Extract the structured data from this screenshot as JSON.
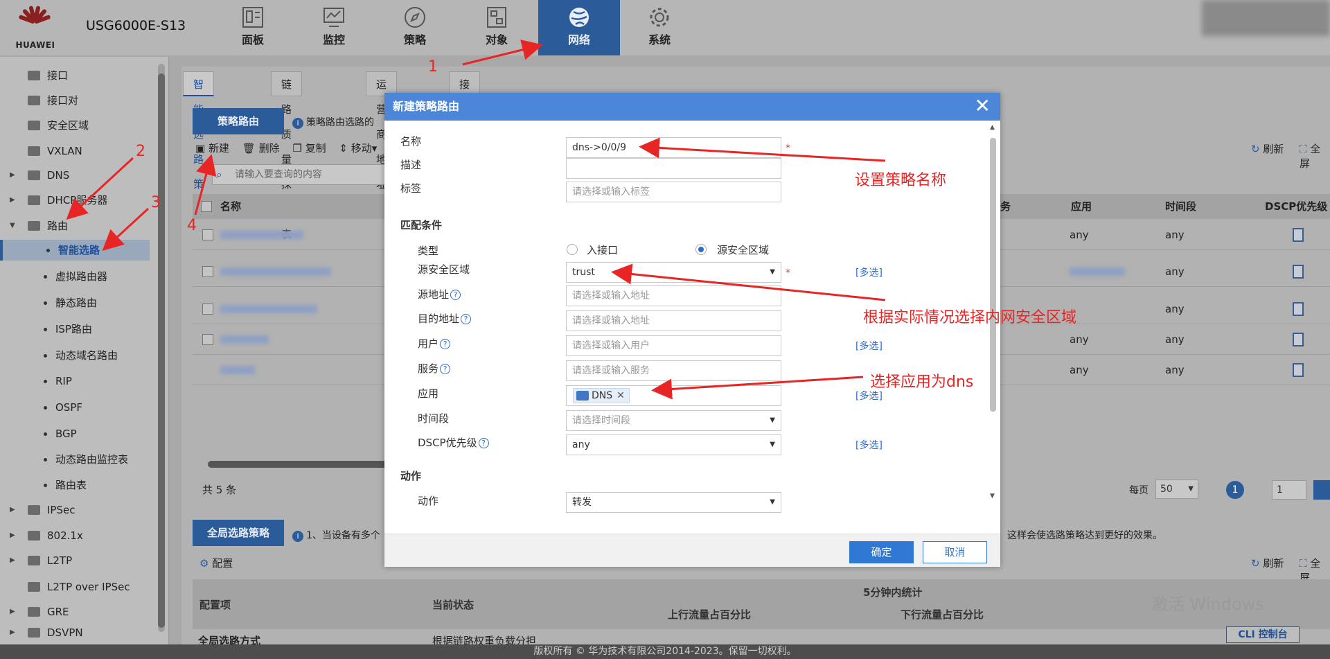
{
  "header": {
    "brand": "HUAWEI",
    "model": "USG6000E-S13",
    "nav": [
      {
        "label": "面板"
      },
      {
        "label": "监控"
      },
      {
        "label": "策略"
      },
      {
        "label": "对象"
      },
      {
        "label": "网络",
        "active": true
      },
      {
        "label": "系统"
      }
    ]
  },
  "sidebar": {
    "items": [
      {
        "label": "接口",
        "level": 1
      },
      {
        "label": "接口对",
        "level": 1
      },
      {
        "label": "安全区域",
        "level": 1
      },
      {
        "label": "VXLAN",
        "level": 1
      },
      {
        "label": "DNS",
        "level": 1,
        "expandable": true
      },
      {
        "label": "DHCP服务器",
        "level": 1,
        "expandable": true
      },
      {
        "label": "路由",
        "level": 1,
        "expanded": true
      },
      {
        "label": "智能选路",
        "level": 2,
        "active": true
      },
      {
        "label": "虚拟路由器",
        "level": 2
      },
      {
        "label": "静态路由",
        "level": 2
      },
      {
        "label": "ISP路由",
        "level": 2
      },
      {
        "label": "动态域名路由",
        "level": 2
      },
      {
        "label": "RIP",
        "level": 2
      },
      {
        "label": "OSPF",
        "level": 2
      },
      {
        "label": "BGP",
        "level": 2
      },
      {
        "label": "动态路由监控表",
        "level": 2
      },
      {
        "label": "路由表",
        "level": 2
      },
      {
        "label": "IPSec",
        "level": 1,
        "expandable": true
      },
      {
        "label": "802.1x",
        "level": 1,
        "expandable": true
      },
      {
        "label": "L2TP",
        "level": 1,
        "expandable": true
      },
      {
        "label": "L2TP over IPSec",
        "level": 1
      },
      {
        "label": "GRE",
        "level": 1,
        "expandable": true
      },
      {
        "label": "DSVPN",
        "level": 1,
        "expandable": true
      }
    ]
  },
  "tabs": [
    {
      "label": "智能选路策略",
      "active": true
    },
    {
      "label": "链路质量探测表"
    },
    {
      "label": "运营商地址库"
    },
    {
      "label": "接口组"
    }
  ],
  "policy_section": {
    "title": "策略路由",
    "info": "策略路由选路的",
    "toolbar": {
      "new": "新建",
      "delete": "删除",
      "copy": "复制",
      "move": "移动▾"
    },
    "refresh": "刷新",
    "fullscreen": "全屏",
    "search_placeholder": "请输入要查询的内容",
    "columns": {
      "name": "名称",
      "app": "应用",
      "time": "时间段",
      "dscp": "DSCP优先级",
      "partial": "务"
    },
    "rows": [
      {
        "app": "any",
        "time": "any"
      },
      {
        "app": "",
        "time": "any"
      },
      {
        "app": "",
        "time": "any"
      },
      {
        "app": "any",
        "time": "any"
      },
      {
        "app": "any",
        "time": "any"
      }
    ],
    "total": "共 5 条",
    "per_page_label": "每页",
    "per_page": "50",
    "current_page": "1",
    "page_input": "1"
  },
  "global_section": {
    "title": "全局选路策略",
    "info": "1、当设备有多个",
    "info_tail": "这样会使选路策略达到更好的效果。",
    "config": "配置",
    "refresh": "刷新",
    "fullscreen": "全屏",
    "columns": {
      "item": "配置项",
      "status": "当前状态",
      "stats": "5分钟内统计",
      "up": "上行流量占百分比",
      "down": "下行流量占百分比"
    },
    "row": {
      "item": "全局选路方式",
      "status": "根据链路权重负载分担"
    }
  },
  "dialog": {
    "title": "新建策略路由",
    "fields": {
      "name_label": "名称",
      "name_value": "dns->0/0/9",
      "desc_label": "描述",
      "tag_label": "标签",
      "tag_placeholder": "请选择或输入标签",
      "match_section": "匹配条件",
      "type_label": "类型",
      "type_opt1": "入接口",
      "type_opt2": "源安全区域",
      "src_zone_label": "源安全区域",
      "src_zone_value": "trust",
      "src_addr_label": "源地址",
      "src_addr_placeholder": "请选择或输入地址",
      "dst_addr_label": "目的地址",
      "dst_addr_placeholder": "请选择或输入地址",
      "user_label": "用户",
      "user_placeholder": "请选择或输入用户",
      "service_label": "服务",
      "service_placeholder": "请选择或输入服务",
      "app_label": "应用",
      "app_tag": "DNS",
      "time_label": "时间段",
      "time_placeholder": "请选择时间段",
      "dscp_label": "DSCP优先级",
      "dscp_value": "any",
      "action_section": "动作",
      "action_label": "动作",
      "action_value": "转发",
      "multi": "[多选]",
      "required": "*"
    },
    "ok": "确定",
    "cancel": "取消"
  },
  "annotations": {
    "n1": "1",
    "n2": "2",
    "n3": "3",
    "n4": "4",
    "set_name": "设置策略名称",
    "choose_zone": "根据实际情况选择内网安全区域",
    "choose_app": "选择应用为dns"
  },
  "footer": {
    "copyright": "版权所有 © 华为技术有限公司2014-2023。保留一切权利。"
  },
  "watermark": {
    "text": "激活 Windows"
  },
  "cli": {
    "label": "CLI 控制台"
  },
  "colors": {
    "accent": "#2c5b9a",
    "dialog_title": "#4b86d8",
    "annotation": "#e82525",
    "link": "#2c6bd0"
  }
}
